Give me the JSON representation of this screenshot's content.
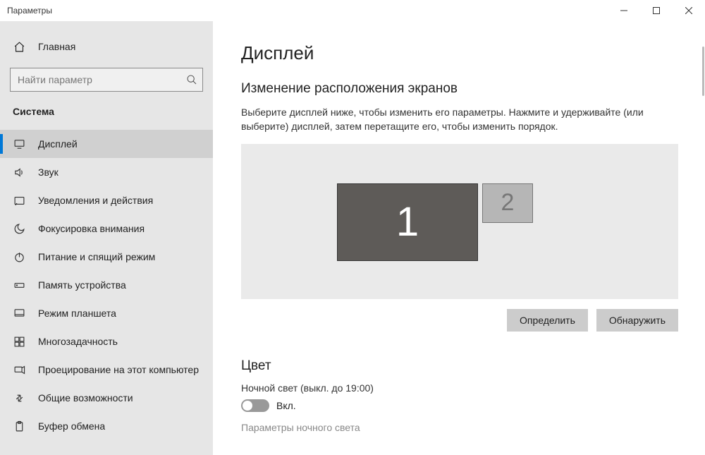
{
  "window": {
    "title": "Параметры"
  },
  "sidebar": {
    "home_label": "Главная",
    "search_placeholder": "Найти параметр",
    "category": "Система",
    "items": [
      {
        "label": "Дисплей"
      },
      {
        "label": "Звук"
      },
      {
        "label": "Уведомления и действия"
      },
      {
        "label": "Фокусировка внимания"
      },
      {
        "label": "Питание и спящий режим"
      },
      {
        "label": "Память устройства"
      },
      {
        "label": "Режим планшета"
      },
      {
        "label": "Многозадачность"
      },
      {
        "label": "Проецирование на этот компьютер"
      },
      {
        "label": "Общие возможности"
      },
      {
        "label": "Буфер обмена"
      }
    ]
  },
  "main": {
    "title": "Дисплей",
    "arrange": {
      "heading": "Изменение расположения экранов",
      "description": "Выберите дисплей ниже, чтобы изменить его параметры. Нажмите и удерживайте (или выберите) дисплей, затем перетащите его, чтобы изменить порядок.",
      "monitor1": "1",
      "monitor2": "2",
      "identify_btn": "Определить",
      "detect_btn": "Обнаружить"
    },
    "color": {
      "heading": "Цвет",
      "night_light_label": "Ночной свет (выкл. до 19:00)",
      "toggle_on_label": "Вкл.",
      "night_light_settings_link": "Параметры ночного света"
    }
  }
}
